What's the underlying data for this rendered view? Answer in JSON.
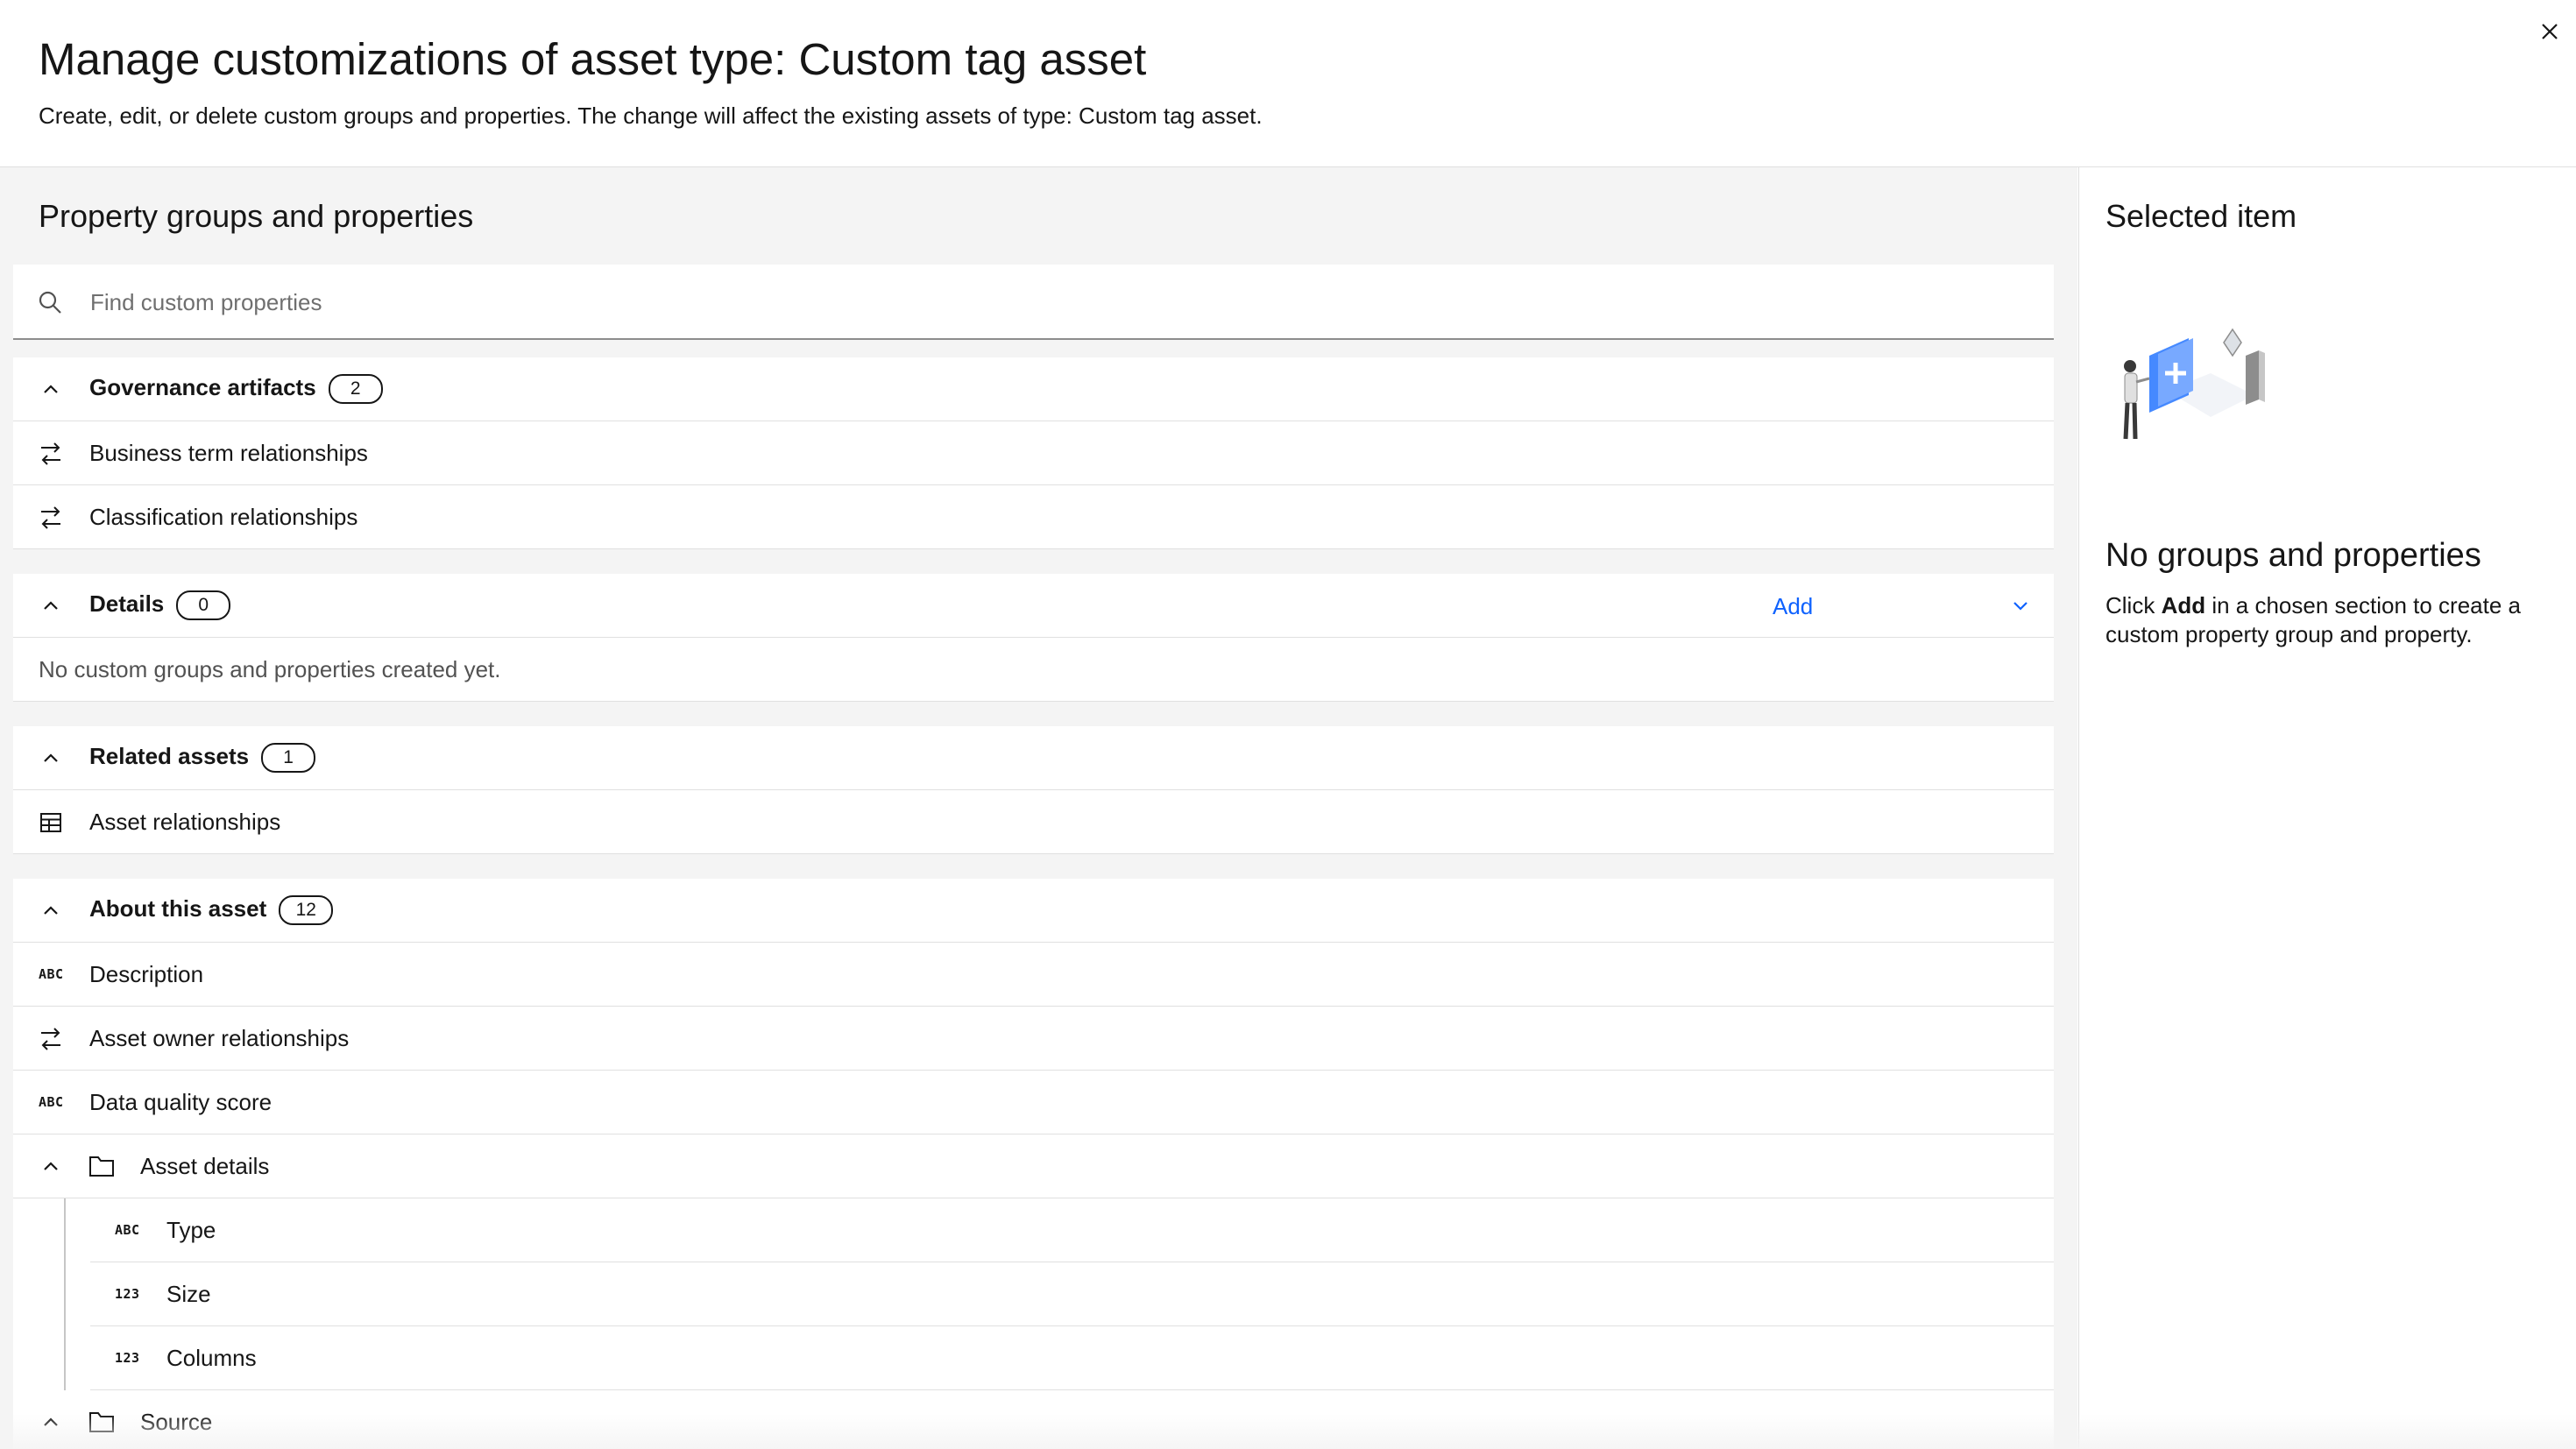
{
  "header": {
    "title": "Manage customizations of asset type: Custom tag asset",
    "subtitle": "Create, edit, or delete custom groups and properties. The change will affect the existing assets of type: Custom tag asset.",
    "close_icon": "close-icon"
  },
  "left_panel": {
    "title": "Property groups and properties",
    "search": {
      "placeholder": "Find custom properties",
      "value": "",
      "icon": "search-icon"
    },
    "sections": [
      {
        "label": "Governance artifacts",
        "count": "2",
        "items": [
          {
            "icon": "relationship-icon",
            "label": "Business term relationships"
          },
          {
            "icon": "relationship-icon",
            "label": "Classification relationships"
          }
        ]
      },
      {
        "label": "Details",
        "count": "0",
        "add_label": "Add",
        "empty_text": "No custom groups and properties created yet."
      },
      {
        "label": "Related assets",
        "count": "1",
        "items": [
          {
            "icon": "table-icon",
            "label": "Asset relationships"
          }
        ]
      },
      {
        "label": "About this asset",
        "count": "12",
        "items": [
          {
            "icon": "text-type-icon",
            "glyph": "ABC",
            "label": "Description"
          },
          {
            "icon": "relationship-icon",
            "label": "Asset owner relationships"
          },
          {
            "icon": "text-type-icon",
            "glyph": "ABC",
            "label": "Data quality score"
          }
        ],
        "groups": [
          {
            "icon": "folder-icon",
            "label": "Asset details",
            "items": [
              {
                "icon": "text-type-icon",
                "glyph": "ABC",
                "label": "Type"
              },
              {
                "icon": "number-type-icon",
                "glyph": "123",
                "label": "Size"
              },
              {
                "icon": "number-type-icon",
                "glyph": "123",
                "label": "Columns"
              }
            ]
          },
          {
            "icon": "folder-icon",
            "label": "Source"
          }
        ]
      }
    ]
  },
  "right_panel": {
    "title": "Selected item",
    "empty_title": "No groups and properties",
    "empty_desc_pre": "Click ",
    "empty_desc_bold": "Add",
    "empty_desc_post": " in a chosen section to create a custom property group and property."
  },
  "colors": {
    "accent": "#0f62fe",
    "panel_bg": "#f4f4f4",
    "text": "#161616",
    "border": "#e0e0e0"
  }
}
